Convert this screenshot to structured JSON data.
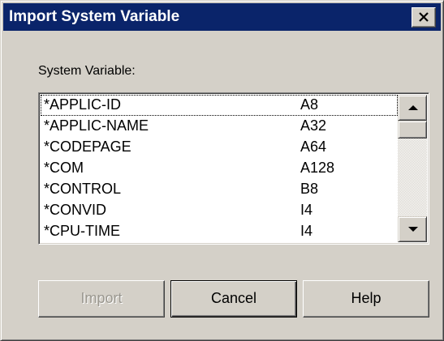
{
  "dialog": {
    "title": "Import System Variable",
    "close_icon": "close-icon"
  },
  "list_label": "System Variable:",
  "variables": [
    {
      "name": "*APPLIC-ID",
      "type": "A8"
    },
    {
      "name": "*APPLIC-NAME",
      "type": "A32"
    },
    {
      "name": "*CODEPAGE",
      "type": "A64"
    },
    {
      "name": "*COM",
      "type": "A128"
    },
    {
      "name": "*CONTROL",
      "type": "B8"
    },
    {
      "name": "*CONVID",
      "type": "I4"
    },
    {
      "name": "*CPU-TIME",
      "type": "I4"
    }
  ],
  "focused_index": 0,
  "scrollbar": {
    "up_icon": "scroll-up-arrow-icon",
    "down_icon": "scroll-down-arrow-icon"
  },
  "buttons": {
    "import": "Import",
    "cancel": "Cancel",
    "help": "Help"
  },
  "colors": {
    "titlebar": "#0a246a",
    "face": "#d4d0c8",
    "disabled_text": "#9a978f"
  }
}
